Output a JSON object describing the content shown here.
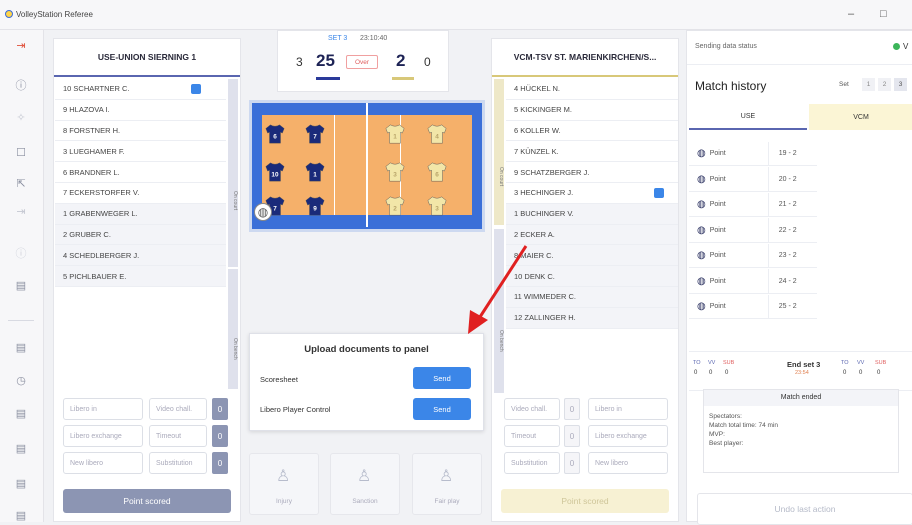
{
  "app": {
    "title": "VolleyStation Referee",
    "win_min": "–",
    "win_max": "□"
  },
  "sidebar": {
    "icons": [
      "exit-icon",
      "info-icon",
      "settings-icon",
      "stop-icon",
      "export-icon",
      "import-icon",
      "disabled-icon",
      "document-icon",
      "list-icon",
      "timer-icon",
      "sheet-icon",
      "report-icon",
      "print-icon",
      "doc-icon"
    ]
  },
  "header": {
    "set_label": "SET 3",
    "time": "23:10:40",
    "home_sets": "3",
    "home_points": "25",
    "away_points": "2",
    "away_sets": "0",
    "status_badge": "Over"
  },
  "home": {
    "name": "USE-UNION SIERNING 1",
    "court_label": "On court",
    "bench_label": "On bench",
    "players": [
      {
        "label": "10 SCHARTNER C.",
        "captain": true
      },
      {
        "label": "9 HLAZOVA I."
      },
      {
        "label": "8 FORSTNER H."
      },
      {
        "label": "3 LUEGHAMER F."
      },
      {
        "label": "6 BRANDNER L."
      },
      {
        "label": "7 ECKERSTORFER V."
      },
      {
        "label": "1 GRABENWEGER L."
      },
      {
        "label": "2 GRUBER C."
      },
      {
        "label": "4 SCHEDLBERGER J."
      },
      {
        "label": "5 PICHLBAUER E."
      }
    ],
    "controls": {
      "libero_in": "Libero in",
      "video_chall": "Video chall.",
      "video_count": "0",
      "libero_exchange": "Libero exchange",
      "timeout": "Timeout",
      "timeout_count": "0",
      "new_libero": "New libero",
      "substitution": "Substitution",
      "sub_count": "0"
    },
    "point_scored": "Point scored"
  },
  "away": {
    "name": "VCM-TSV ST. MARIENKIRCHEN/S...",
    "court_label": "On court",
    "bench_label": "On bench",
    "players": [
      {
        "label": "4 HÜCKEL N."
      },
      {
        "label": "5 KICKINGER M."
      },
      {
        "label": "6 KOLLER W."
      },
      {
        "label": "7 KÜNZEL K."
      },
      {
        "label": "9 SCHATZBERGER J."
      },
      {
        "label": "3 HECHINGER J.",
        "captain": true
      },
      {
        "label": "1 BUCHINGER V."
      },
      {
        "label": "2 ECKER A."
      },
      {
        "label": "8 MAIER C."
      },
      {
        "label": "10 DENK C."
      },
      {
        "label": "11 WIMMEDER C."
      },
      {
        "label": "12 ZALLINGER H."
      }
    ],
    "controls": {
      "video_chall": "Video chall.",
      "video_count": "0",
      "libero_in": "Libero in",
      "timeout": "Timeout",
      "timeout_count": "0",
      "libero_exchange": "Libero exchange",
      "substitution": "Substitution",
      "sub_count": "0",
      "new_libero": "New libero"
    },
    "point_scored": "Point scored"
  },
  "court": {
    "home_numbers": [
      "6",
      "7",
      "10",
      "1",
      "7",
      "9"
    ],
    "away_numbers": [
      "1",
      "4",
      "3",
      "6",
      "2",
      "3"
    ],
    "home_color": "#1a2a7a",
    "away_color": "#f2e6a8",
    "floor_color": "#f5b06a"
  },
  "upload": {
    "title": "Upload documents to panel",
    "items": [
      {
        "label": "Scoresheet",
        "button": "Send"
      },
      {
        "label": "Libero Player Control",
        "button": "Send"
      }
    ]
  },
  "actions": [
    {
      "label": "Injury"
    },
    {
      "label": "Sanction"
    },
    {
      "label": "Fair play"
    }
  ],
  "right": {
    "sending_status": "Sending data status",
    "status_letter": "V",
    "history_title": "Match history",
    "set_label": "Set",
    "set_tabs": [
      "1",
      "2",
      "3"
    ],
    "tab_home": "USE",
    "tab_away": "VCM",
    "history": [
      {
        "label": "Point",
        "score": "19 - 2"
      },
      {
        "label": "Point",
        "score": "20 - 2"
      },
      {
        "label": "Point",
        "score": "21 - 2"
      },
      {
        "label": "Point",
        "score": "22 - 2"
      },
      {
        "label": "Point",
        "score": "23 - 2"
      },
      {
        "label": "Point",
        "score": "24 - 2"
      },
      {
        "label": "Point",
        "score": "25 - 2"
      }
    ],
    "endset": {
      "label": "End set 3",
      "time": "23:54",
      "to": "TO",
      "vv": "VV",
      "sub": "SUB",
      "h_to": "0",
      "h_vv": "0",
      "h_sub": "0",
      "a_to": "0",
      "a_vv": "0",
      "a_sub": "0"
    },
    "match_ended": {
      "title": "Match ended",
      "spectators": "Spectators:",
      "total_time": "Match total time: 74 min",
      "mvp": "MVP:",
      "best_player": "Best player:"
    },
    "undo": "Undo last action"
  },
  "colors": {
    "accent": "#3b86e8",
    "home_accent": "#2a3a9a",
    "away_accent": "#d8c879",
    "point_scored_home": "#8c95b3",
    "point_scored_away": "#f7f1d3",
    "arrow": "#e02020"
  }
}
